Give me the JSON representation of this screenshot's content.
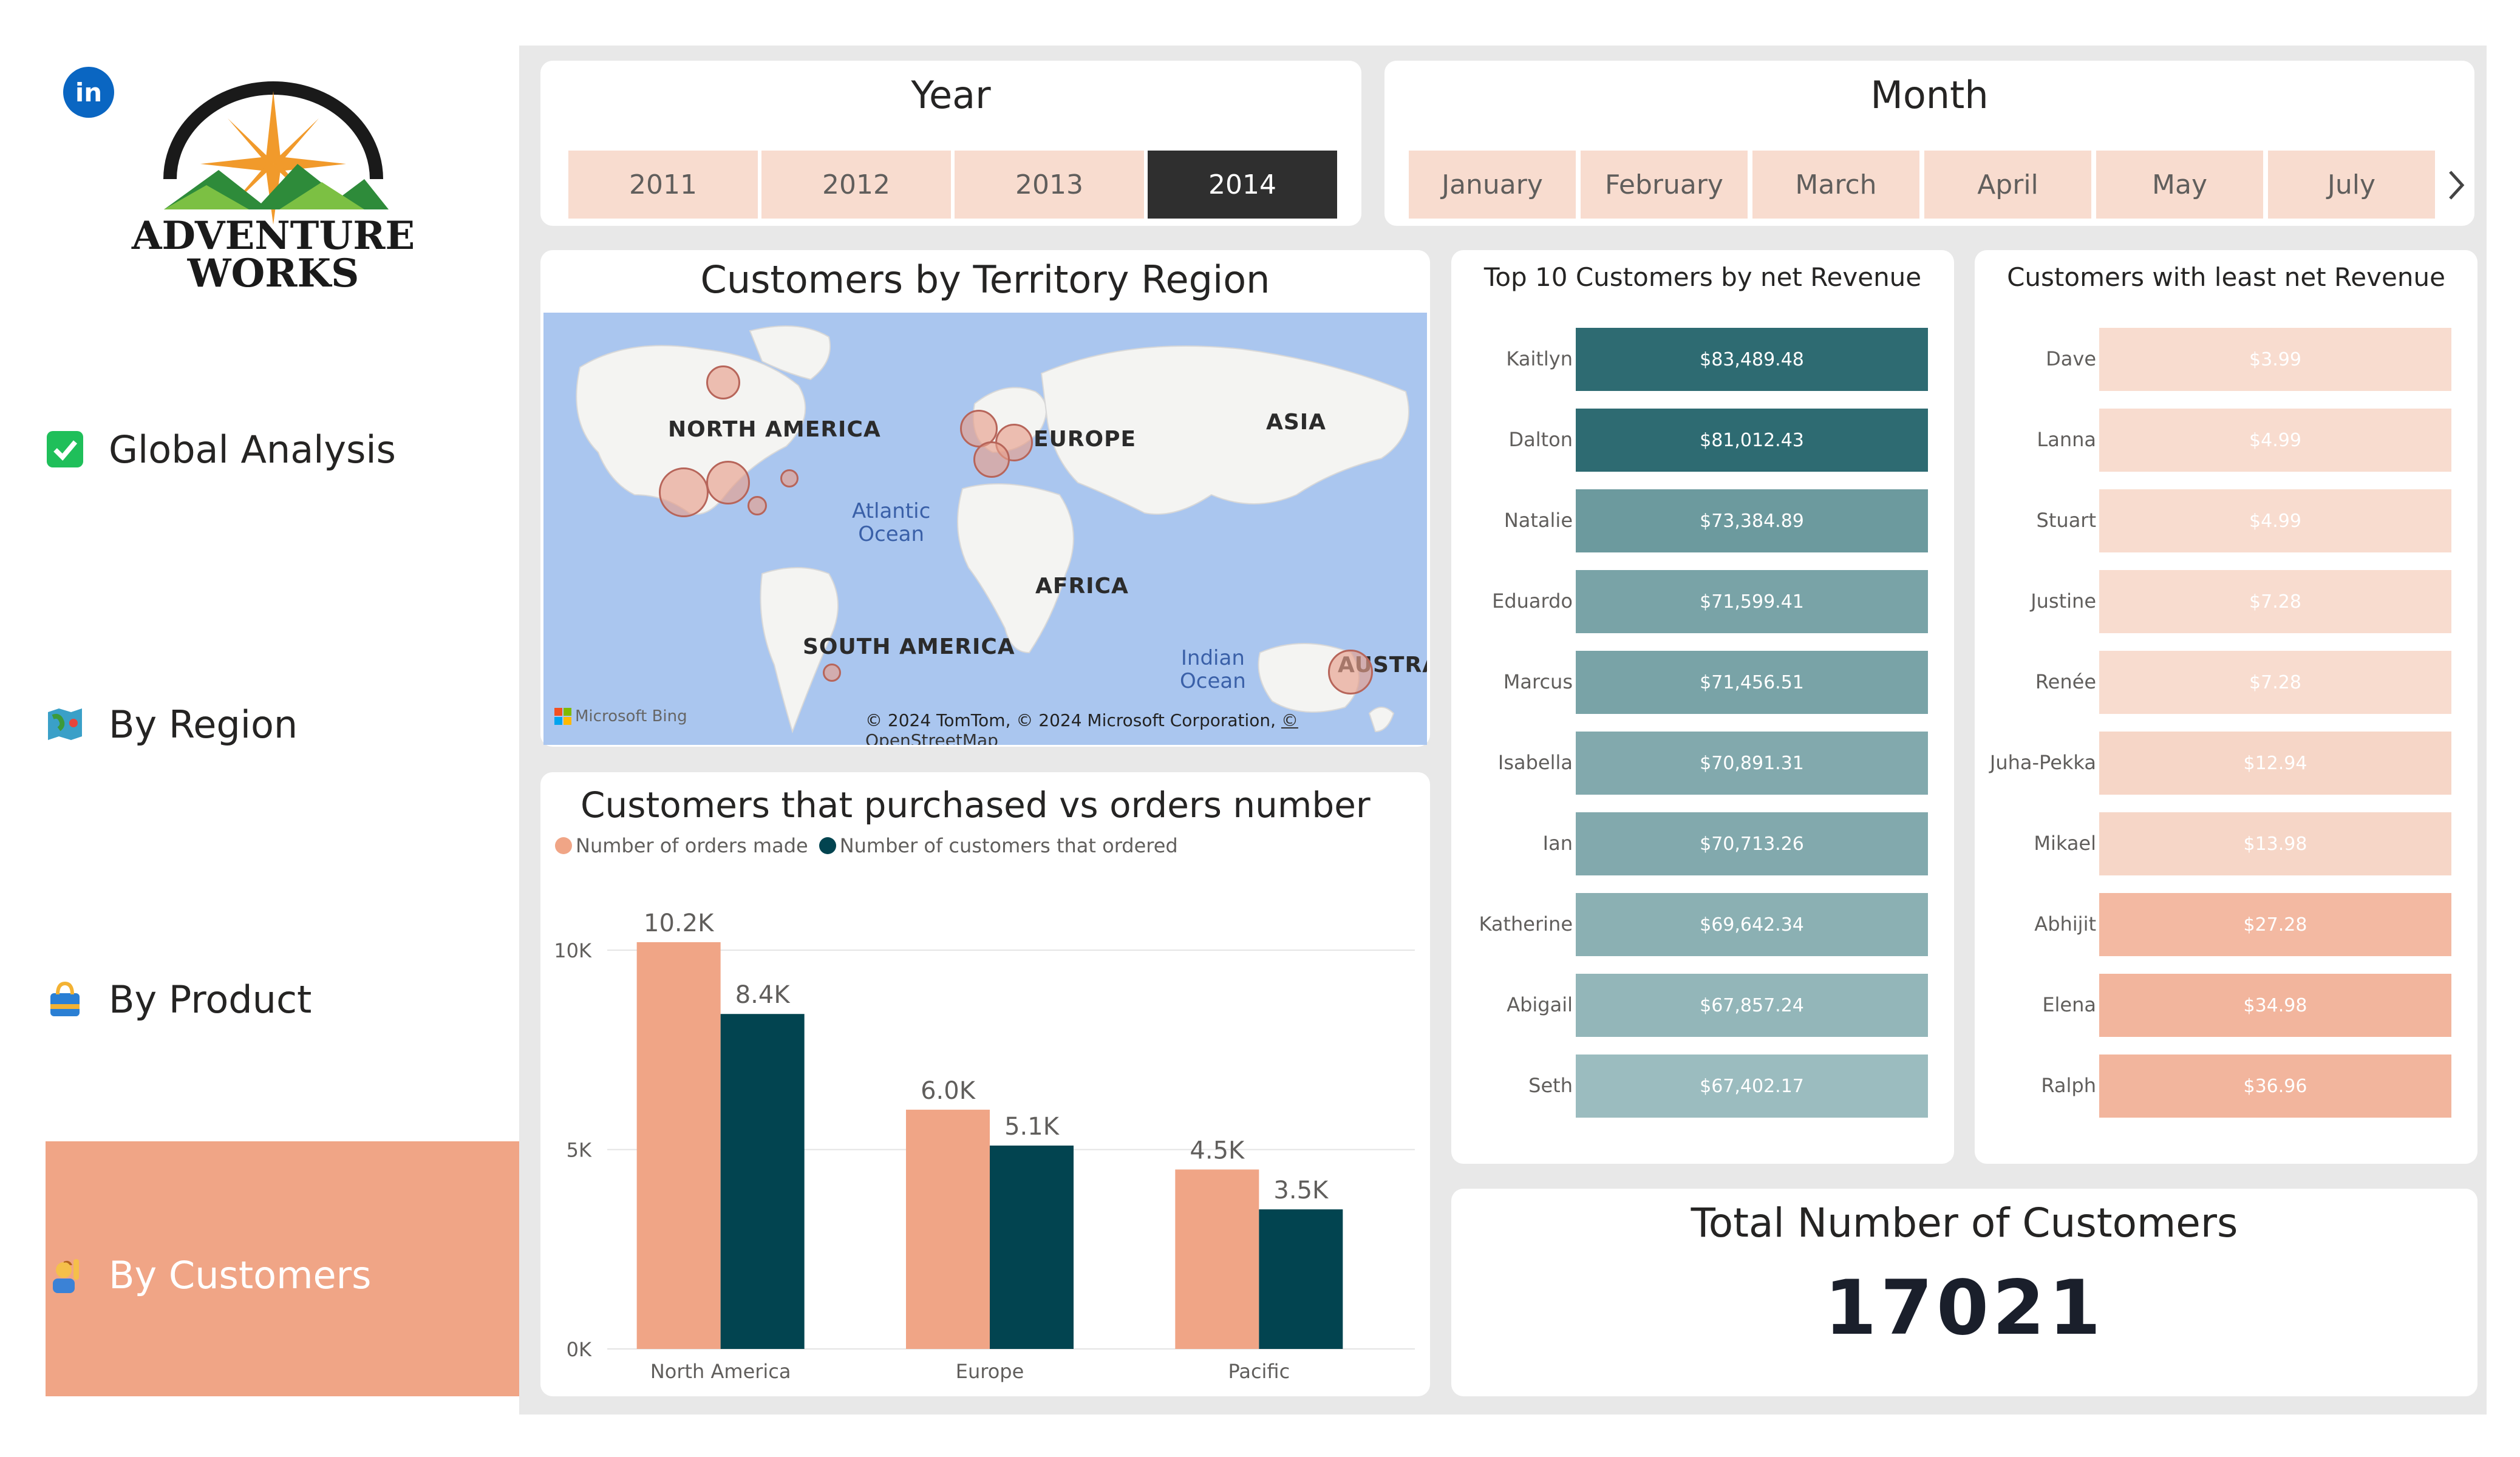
{
  "sidebar": {
    "linkedin_label": "in",
    "logo_line1": "ADVENTURE",
    "logo_line2": "WORKS",
    "nav": [
      {
        "label": "Global Analysis",
        "icon": "checkmark-icon"
      },
      {
        "label": "By Region",
        "icon": "map-icon"
      },
      {
        "label": "By Product",
        "icon": "shopping-bag-icon"
      },
      {
        "label": "By Customers",
        "icon": "person-raising-hand-icon"
      }
    ]
  },
  "year_slicer": {
    "title": "Year",
    "options": [
      "2011",
      "2012",
      "2013",
      "2014"
    ],
    "selected": "2014"
  },
  "month_slicer": {
    "title": "Month",
    "options": [
      "January",
      "February",
      "March",
      "April",
      "May",
      "July"
    ],
    "next_icon": "chevron-right-icon"
  },
  "map_card": {
    "title": "Customers by Territory Region",
    "labels": {
      "north_america": "NORTH AMERICA",
      "europe": "EUROPE",
      "asia": "ASIA",
      "africa": "AFRICA",
      "south_america": "SOUTH AMERICA",
      "australia": "AUSTRAI",
      "atlantic_line1": "Atlantic",
      "atlantic_line2": "Ocean",
      "indian_line1": "Indian",
      "indian_line2": "Ocean"
    },
    "bing": "Microsoft Bing",
    "copyright": "© 2024 TomTom, © 2024 Microsoft Corporation,",
    "copyright_link": "© OpenStreetMap"
  },
  "top_customers": {
    "title": "Top 10 Customers by net Revenue",
    "rows": [
      {
        "name": "Kaitlyn",
        "value": "$83,489.48",
        "amount": 83489.48
      },
      {
        "name": "Dalton",
        "value": "$81,012.43",
        "amount": 81012.43
      },
      {
        "name": "Natalie",
        "value": "$73,384.89",
        "amount": 73384.89
      },
      {
        "name": "Eduardo",
        "value": "$71,599.41",
        "amount": 71599.41
      },
      {
        "name": "Marcus",
        "value": "$71,456.51",
        "amount": 71456.51
      },
      {
        "name": "Isabella",
        "value": "$70,891.31",
        "amount": 70891.31
      },
      {
        "name": "Ian",
        "value": "$70,713.26",
        "amount": 70713.26
      },
      {
        "name": "Katherine",
        "value": "$69,642.34",
        "amount": 69642.34
      },
      {
        "name": "Abigail",
        "value": "$67,857.24",
        "amount": 67857.24
      },
      {
        "name": "Seth",
        "value": "$67,402.17",
        "amount": 67402.17
      }
    ]
  },
  "least_customers": {
    "title": "Customers with least net Revenue",
    "rows": [
      {
        "name": "Dave",
        "value": "$3.99",
        "amount": 3.99
      },
      {
        "name": "Lanna",
        "value": "$4.99",
        "amount": 4.99
      },
      {
        "name": "Stuart",
        "value": "$4.99",
        "amount": 4.99
      },
      {
        "name": "Justine",
        "value": "$7.28",
        "amount": 7.28
      },
      {
        "name": "Renée",
        "value": "$7.28",
        "amount": 7.28
      },
      {
        "name": "Juha-Pekka",
        "value": "$12.94",
        "amount": 12.94
      },
      {
        "name": "Mikael",
        "value": "$13.98",
        "amount": 13.98
      },
      {
        "name": "Abhijit",
        "value": "$27.28",
        "amount": 27.28
      },
      {
        "name": "Elena",
        "value": "$34.98",
        "amount": 34.98
      },
      {
        "name": "Ralph",
        "value": "$36.96",
        "amount": 36.96
      }
    ]
  },
  "total_card": {
    "title": "Total Number of Customers",
    "value": "17021"
  },
  "colors": {
    "accent": "#f0a586",
    "orders": "#f0a586",
    "customers": "#024450",
    "top_dark": "#2e6b72",
    "least_light": "#f8dccf"
  },
  "chart_data": {
    "type": "bar",
    "title": "Customers that purchased vs orders number",
    "categories": [
      "North America",
      "Europe",
      "Pacific"
    ],
    "series": [
      {
        "name": "Number of orders made",
        "values": [
          10200,
          6000,
          4500
        ],
        "labels": [
          "10.2K",
          "6.0K",
          "4.5K"
        ],
        "color": "#f0a586"
      },
      {
        "name": "Number of customers that ordered",
        "values": [
          8400,
          5100,
          3500
        ],
        "labels": [
          "8.4K",
          "5.1K",
          "3.5K"
        ],
        "color": "#024450"
      }
    ],
    "ylim": [
      0,
      10200
    ],
    "yticks": [
      0,
      5000,
      10000
    ],
    "ytick_labels": [
      "0K",
      "5K",
      "10K"
    ],
    "grid": true,
    "legend": "top-left"
  }
}
